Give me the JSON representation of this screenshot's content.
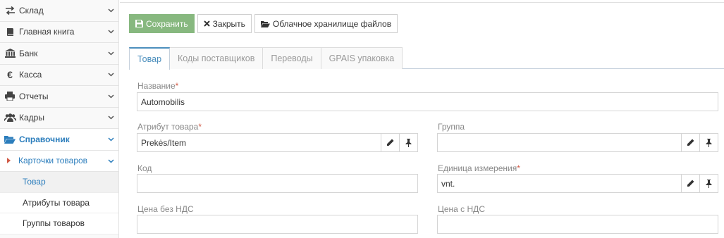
{
  "sidebar": {
    "items": [
      {
        "label": "Склад",
        "icon": "exchange-icon"
      },
      {
        "label": "Главная книга",
        "icon": "book-icon"
      },
      {
        "label": "Банк",
        "icon": "bank-icon"
      },
      {
        "label": "Касса",
        "icon": "euro-icon"
      },
      {
        "label": "Отчеты",
        "icon": "print-icon"
      },
      {
        "label": "Кадры",
        "icon": "users-icon"
      },
      {
        "label": "Справочник",
        "icon": "folder-open-icon"
      }
    ],
    "submenu_label": "Карточки товаров",
    "leaves": [
      "Товар",
      "Атрибуты товара",
      "Группы товаров"
    ]
  },
  "toolbar": {
    "save_label": "Сохранить",
    "close_label": "Закрыть",
    "cloud_label": "Облачное хранилище файлов"
  },
  "tabs": [
    "Товар",
    "Коды поставщиков",
    "Переводы",
    "GPAIS упаковка"
  ],
  "form": {
    "name_label": "Название",
    "name_value": "Automobilis",
    "attr_label": "Атрибут товара",
    "attr_value": "Prekės/Item",
    "group_label": "Группа",
    "group_value": "",
    "code_label": "Код",
    "code_value": "",
    "unit_label": "Единица измерения",
    "unit_value": "vnt.",
    "price_net_label": "Цена без НДС",
    "price_net_value": "",
    "price_vat_label": "Цена с НДС",
    "price_vat_value": "",
    "required_mark": "*"
  },
  "colors": {
    "accent": "#2b7dbc",
    "save_button": "#87b87f",
    "required": "#d15b47"
  }
}
